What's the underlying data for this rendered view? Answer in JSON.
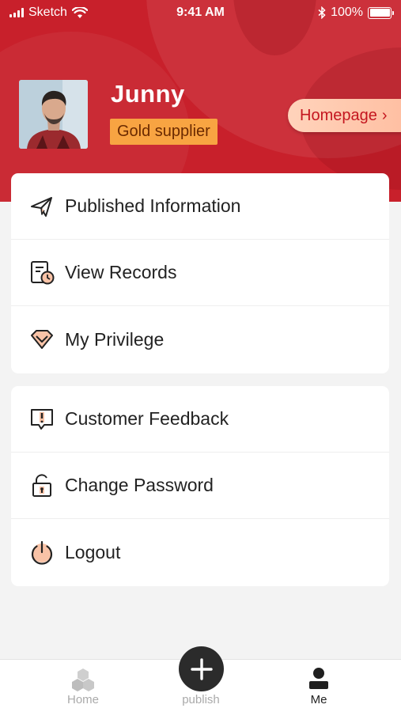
{
  "status_bar": {
    "carrier": "Sketch",
    "time": "9:41 AM",
    "battery": "100%",
    "icons": [
      "signal-icon",
      "wifi-icon",
      "bluetooth-icon",
      "battery-icon"
    ]
  },
  "profile": {
    "name": "Junny",
    "badge": "Gold supplier",
    "homepage_label": "Homepage",
    "homepage_chevron": "›"
  },
  "menu_group_1": [
    {
      "label": "Published Information",
      "icon": "paper-plane-icon"
    },
    {
      "label": "View Records",
      "icon": "records-clock-icon"
    },
    {
      "label": "My Privilege",
      "icon": "diamond-icon"
    }
  ],
  "menu_group_2": [
    {
      "label": "Customer Feedback",
      "icon": "feedback-icon"
    },
    {
      "label": "Change Password",
      "icon": "lock-icon"
    },
    {
      "label": "Logout",
      "icon": "power-icon"
    }
  ],
  "tabbar": {
    "home": "Home",
    "publish": "publish",
    "me": "Me",
    "active": "Me"
  },
  "colors": {
    "brand_red": "#c8202b",
    "badge_orange": "#f8a442",
    "icon_peach": "#f9c3a7"
  }
}
